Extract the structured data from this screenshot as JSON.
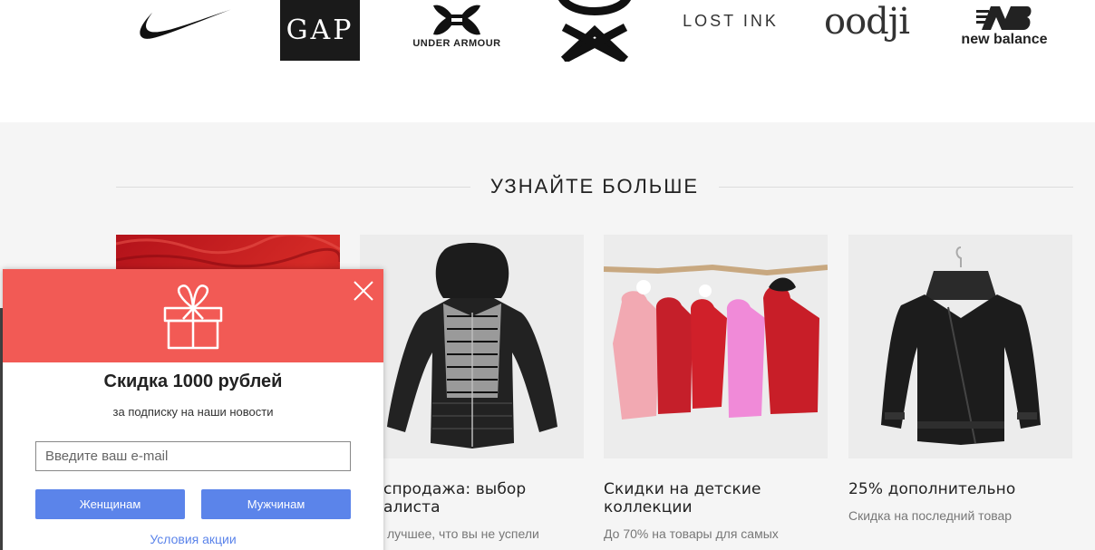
{
  "brands": [
    {
      "name": "Nike",
      "icon": "nike-swoosh-logo"
    },
    {
      "name": "GAP",
      "label": "GAP"
    },
    {
      "name": "Under Armour",
      "label": "UNDER ARMOUR",
      "icon": "under-armour-logo"
    },
    {
      "name": "Benetton",
      "icon": "benetton-knot-logo"
    },
    {
      "name": "Lost Ink",
      "label": "LOST INK"
    },
    {
      "name": "oodji",
      "label": "oodji"
    },
    {
      "name": "New Balance",
      "label": "new balance",
      "icon": "new-balance-logo"
    }
  ],
  "learn_more": {
    "title": "УЗНАЙТЕ БОЛЬШЕ",
    "cards": [
      {
        "title": "",
        "desc": "",
        "image": "red-fur-texture"
      },
      {
        "title": "спродажа: выбор алиста",
        "desc": "лучшее, что вы не успели",
        "image": "black-white-puffer-jacket"
      },
      {
        "title": "Скидки на детские коллекции",
        "desc": "До 70% на товары для самых",
        "image": "kids-coats-on-branch"
      },
      {
        "title": "25% дополнительно",
        "desc": "Скидка на последний товар",
        "image": "black-leather-jacket"
      }
    ]
  },
  "popup": {
    "title": "Скидка 1000 рублей",
    "subtitle": "за подписку на наши новости",
    "email_placeholder": "Введите ваш e-mail",
    "email_value": "",
    "women_button": "Женщинам",
    "men_button": "Мужчинам",
    "terms_link": "Условия акции",
    "icons": {
      "gift": "gift-icon",
      "close": "close-icon"
    }
  },
  "colors": {
    "popup_header": "#f25a55",
    "button": "#5b84ea",
    "section_bg": "#f5f5f5"
  }
}
